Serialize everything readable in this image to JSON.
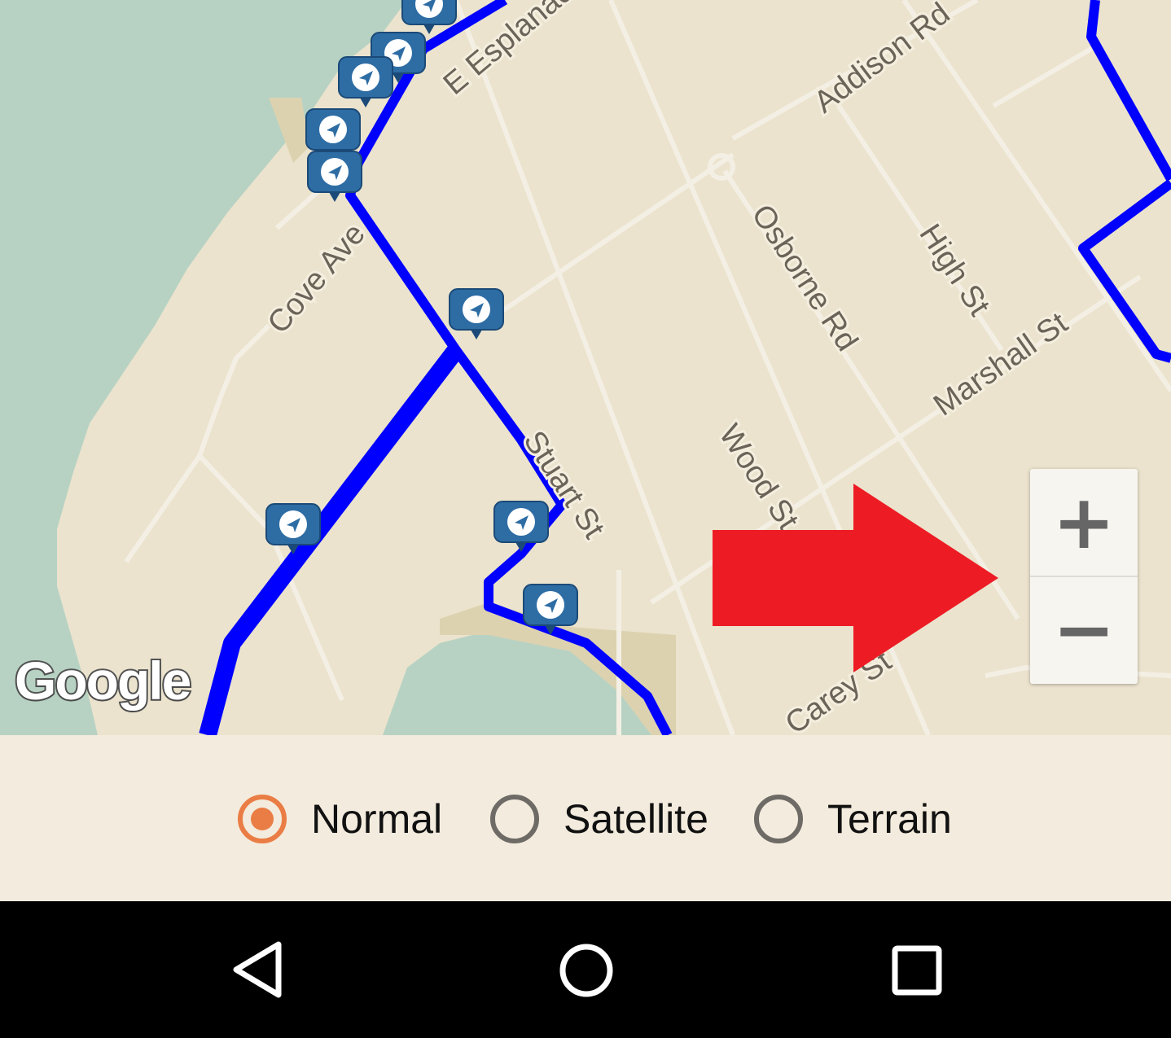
{
  "map": {
    "streets": [
      {
        "name": "E Esplanade"
      },
      {
        "name": "Addison Rd"
      },
      {
        "name": "Cove Ave"
      },
      {
        "name": "Osborne Rd"
      },
      {
        "name": "High St"
      },
      {
        "name": "Marshall St"
      },
      {
        "name": "Stuart St"
      },
      {
        "name": "Wood St"
      },
      {
        "name": "Carey St"
      }
    ],
    "logo": "Google",
    "route_color": "#0000ff",
    "annotation_arrow_color": "#ed1c24",
    "marker_icon": "navigation-arrow-icon"
  },
  "zoom": {
    "in_label": "+",
    "out_label": "−"
  },
  "map_type": {
    "options": [
      "Normal",
      "Satellite",
      "Terrain"
    ],
    "selected": "Normal",
    "accent": "#ea7d45"
  },
  "navbar": {
    "back_icon": "back-triangle-icon",
    "home_icon": "home-circle-icon",
    "recents_icon": "recents-square-icon"
  }
}
